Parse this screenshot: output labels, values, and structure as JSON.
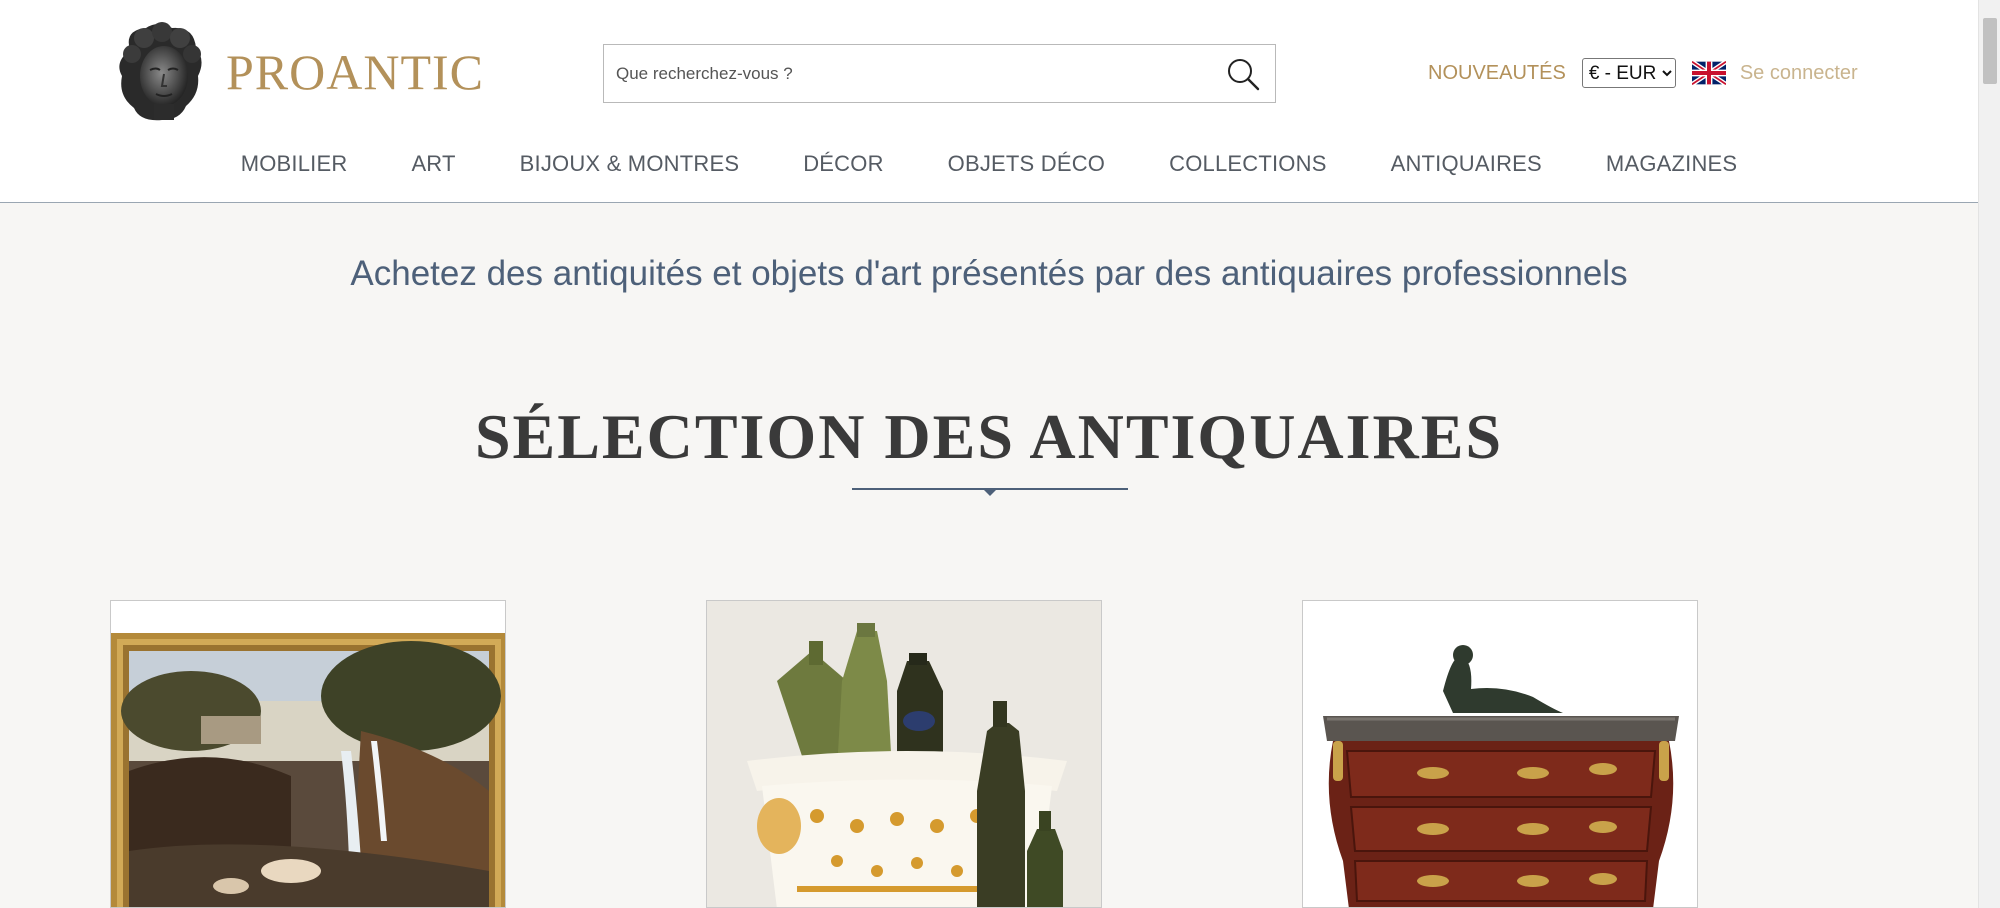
{
  "header": {
    "brand": "PROANTIC",
    "search": {
      "placeholder": "Que recherchez-vous ?",
      "value": ""
    },
    "nouveautes_label": "NOUVEAUTÉS",
    "currency": {
      "selected": "€ - EUR",
      "options": [
        "€ - EUR"
      ]
    },
    "language_flag": "uk-flag-icon",
    "login_label": "Se connecter"
  },
  "nav": {
    "items": [
      {
        "label": "MOBILIER"
      },
      {
        "label": "ART"
      },
      {
        "label": "BIJOUX & MONTRES"
      },
      {
        "label": "DÉCOR"
      },
      {
        "label": "OBJETS DÉCO"
      },
      {
        "label": "COLLECTIONS"
      },
      {
        "label": "ANTIQUAIRES"
      },
      {
        "label": "MAGAZINES"
      }
    ]
  },
  "main": {
    "tagline": "Achetez des antiquités et objets d'art présentés par des antiquaires professionnels",
    "section_title": "SÉLECTION DES ANTIQUAIRES",
    "cards": [
      {
        "image": "framed-landscape-painting-image"
      },
      {
        "image": "faience-wine-cooler-bottles-image"
      },
      {
        "image": "louis-xv-commode-bronze-image"
      }
    ]
  },
  "colors": {
    "brand_gold": "#b3915a",
    "login_gold": "#c9b48e",
    "nav_text": "#555b63",
    "tagline_blue": "#4d6079",
    "background": "#f7f6f4"
  }
}
